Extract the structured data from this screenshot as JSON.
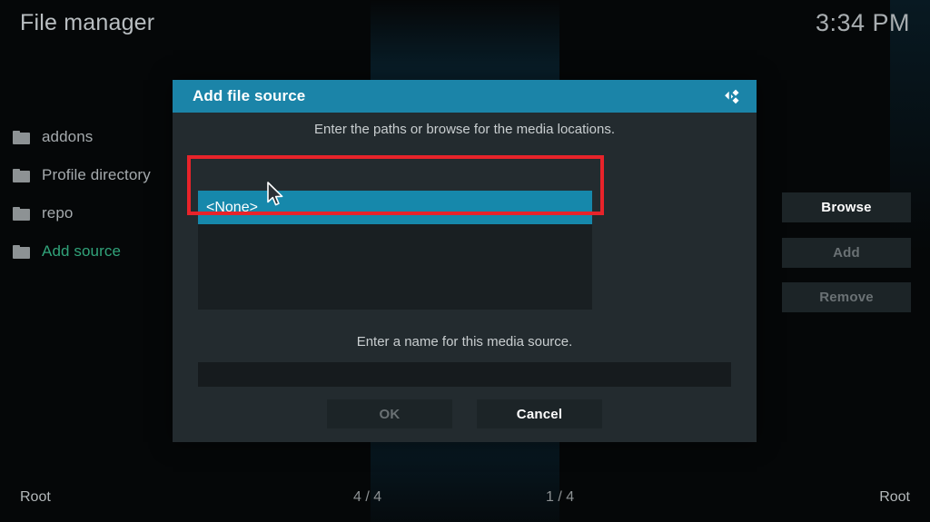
{
  "header": {
    "title": "File manager",
    "clock": "3:34 PM"
  },
  "sidebar": {
    "items": [
      {
        "label": "addons",
        "icon": "folder-icon",
        "selected": false
      },
      {
        "label": "Profile directory",
        "icon": "folder-icon",
        "selected": false
      },
      {
        "label": "repo",
        "icon": "folder-icon",
        "selected": false
      },
      {
        "label": "Add source",
        "icon": "folder-icon",
        "selected": true
      }
    ]
  },
  "dialog": {
    "title": "Add file source",
    "logo_icon": "kodi-logo-icon",
    "hint_top": "Enter the paths or browse for the media locations.",
    "path_list": [
      {
        "label": "<None>",
        "selected": true
      }
    ],
    "buttons": {
      "browse": "Browse",
      "add": "Add",
      "remove": "Remove"
    },
    "hint_name": "Enter a name for this media source.",
    "name_value": "",
    "name_placeholder": "",
    "ok": "OK",
    "cancel": "Cancel"
  },
  "statusbar": {
    "left": "Root",
    "mid_left": "4 / 4",
    "mid_right": "1 / 4",
    "right": "Root"
  },
  "colors": {
    "accent_teal": "#1b84a8",
    "selection_teal": "#1688ab",
    "annotation_red": "#e8232a",
    "selected_item_green": "#31a37a",
    "dialog_bg": "#232b2f",
    "list_bg": "#191f22"
  }
}
